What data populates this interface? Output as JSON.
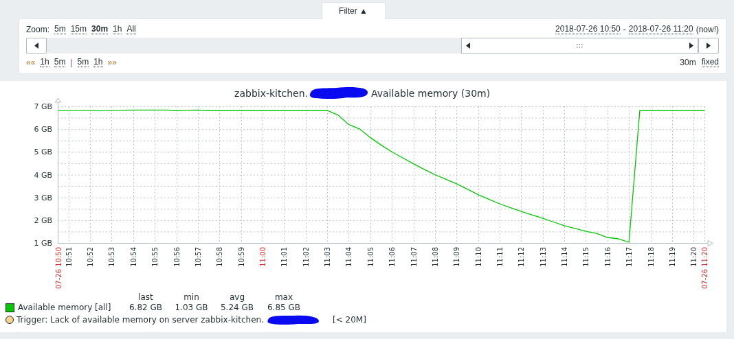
{
  "filter_tab": {
    "label": "Filter ▲"
  },
  "zoom": {
    "label": "Zoom:",
    "options": [
      {
        "label": "5m",
        "selected": false
      },
      {
        "label": "15m",
        "selected": false
      },
      {
        "label": "30m",
        "selected": true
      },
      {
        "label": "1h",
        "selected": false
      },
      {
        "label": "All",
        "selected": false
      }
    ]
  },
  "period": {
    "from": "2018-07-26 10:50",
    "separator": "-",
    "to": "2018-07-26 11:20",
    "note": "(now!)"
  },
  "navigation": [
    {
      "kind": "arrows",
      "label": "««"
    },
    {
      "kind": "link",
      "label": "1h"
    },
    {
      "kind": "link",
      "label": "5m"
    },
    {
      "kind": "separator",
      "label": "|"
    },
    {
      "kind": "link",
      "label": "5m"
    },
    {
      "kind": "link",
      "label": "1h"
    },
    {
      "kind": "arrows",
      "label": "»»"
    }
  ],
  "period_length": "30m",
  "period_mode": "fixed",
  "graph": {
    "host": "zabbix-kitchen.",
    "item": "Available memory (30m)",
    "start_label": "07-26 10:50",
    "end_label": "07-26 11:20",
    "chart_data": {
      "type": "line",
      "ylim": [
        1,
        7
      ],
      "categories": [
        null,
        "10:51",
        null,
        "10:52",
        null,
        "10:53",
        null,
        "10:54",
        null,
        "10:55",
        null,
        "10:56",
        null,
        "10:57",
        null,
        "10:58",
        null,
        "10:59",
        null,
        null,
        null,
        "11:01",
        null,
        "11:02",
        null,
        "11:03",
        null,
        "11:04",
        null,
        "11:05",
        null,
        "11:06",
        null,
        "11:07",
        null,
        "11:08",
        null,
        "11:09",
        null,
        "11:10",
        null,
        "11:11",
        null,
        "11:12",
        null,
        "11:13",
        null,
        "11:14",
        null,
        "11:15",
        null,
        "11:16",
        null,
        "11:17",
        null,
        "11:18",
        null,
        "11:19",
        null,
        "11:20",
        null
      ],
      "series": [
        {
          "name": "Available memory",
          "color": "#00c800",
          "values": [
            6.83,
            6.83,
            6.83,
            6.83,
            6.81,
            6.83,
            6.83,
            6.84,
            6.84,
            6.84,
            6.84,
            6.82,
            6.83,
            6.84,
            6.82,
            6.82,
            6.82,
            6.82,
            6.82,
            6.82,
            6.82,
            6.82,
            6.82,
            6.82,
            6.82,
            6.82,
            6.62,
            6.2,
            6.01,
            5.63,
            5.3,
            5.0,
            4.74,
            4.48,
            4.23,
            4.0,
            3.8,
            3.6,
            3.36,
            3.12,
            2.92,
            2.72,
            2.55,
            2.38,
            2.23,
            2.08,
            1.92,
            1.76,
            1.64,
            1.51,
            1.42,
            1.24,
            1.18,
            1.03,
            6.82,
            6.82,
            6.82,
            6.82,
            6.82,
            6.82,
            6.82
          ]
        }
      ],
      "annotations": [
        "11:00"
      ],
      "grid": true,
      "yticks": [
        {
          "value": 1,
          "label": "1 GB"
        },
        {
          "value": 2,
          "label": "2 GB"
        },
        {
          "value": 3,
          "label": "3 GB"
        },
        {
          "value": 4,
          "label": "4 GB"
        },
        {
          "value": 5,
          "label": "5 GB"
        },
        {
          "value": 6,
          "label": "6 GB"
        },
        {
          "value": 7,
          "label": "7 GB"
        }
      ]
    },
    "legend": {
      "columns": [
        "last",
        "min",
        "avg",
        "max"
      ],
      "items": [
        {
          "function": "[all]",
          "values": [
            "6.82 GB",
            "1.03 GB",
            "5.24 GB",
            "6.85 GB"
          ]
        }
      ]
    },
    "trigger": {
      "text": "Trigger: Lack of available memory on server zabbix-kitchen.",
      "threshold": "[< 20M]"
    }
  }
}
